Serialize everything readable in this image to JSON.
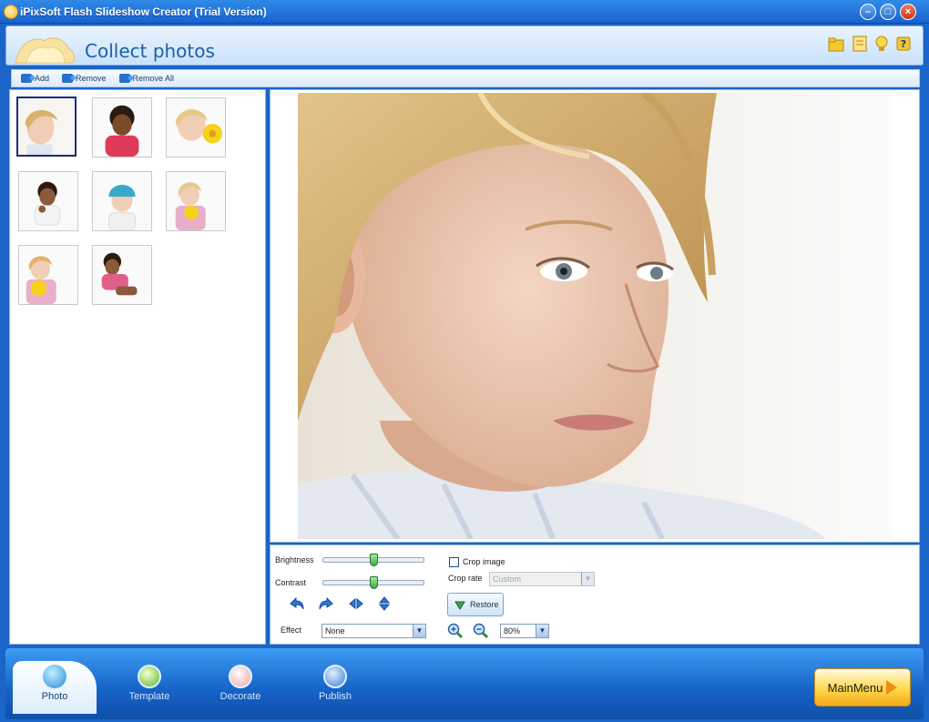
{
  "window": {
    "title": "iPixSoft Flash Slideshow Creator (Trial Version)"
  },
  "header": {
    "title": "Collect photos"
  },
  "toolbar": {
    "add_label": "Add",
    "remove_label": "Remove",
    "remove_all_label": "Remove All"
  },
  "thumbnails": [
    {
      "subject": "blonde-girl-profile",
      "selected": true
    },
    {
      "subject": "curly-haired-child-pink-shirt",
      "selected": false
    },
    {
      "subject": "blonde-child-yellow-flower",
      "selected": false
    },
    {
      "subject": "dark-haired-toddler-eating",
      "selected": false
    },
    {
      "subject": "child-blue-hat",
      "selected": false
    },
    {
      "subject": "blonde-girl-yellow-flower",
      "selected": false
    },
    {
      "subject": "blonde-toddler-yellow-flower",
      "selected": false
    },
    {
      "subject": "toddler-pink-shirt-sitting",
      "selected": false
    }
  ],
  "controls": {
    "brightness_label": "Brightness",
    "brightness_value": 0.5,
    "contrast_label": "Contrast",
    "contrast_value": 0.5,
    "effect_label": "Effect",
    "effect_value": "None",
    "crop_image_label": "Crop image",
    "crop_image_checked": false,
    "crop_rate_label": "Crop rate",
    "crop_rate_value": "Custom",
    "restore_label": "Restore",
    "zoom_value": "80%"
  },
  "nav": {
    "tabs": [
      {
        "label": "Photo",
        "active": true
      },
      {
        "label": "Template",
        "active": false
      },
      {
        "label": "Decorate",
        "active": false
      },
      {
        "label": "Publish",
        "active": false
      }
    ],
    "main_menu_label": "MainMenu"
  },
  "colors": {
    "title_bar": "#1a62cf",
    "accent": "#1f5fa8",
    "main_menu": "#ffd84a"
  }
}
